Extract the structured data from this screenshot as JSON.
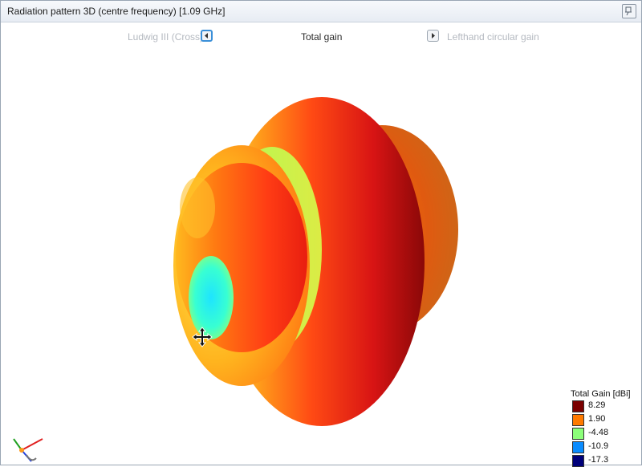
{
  "window": {
    "title": "Radiation pattern 3D (centre frequency) [1.09 GHz]"
  },
  "nav": {
    "prev_label": "Ludwig III (Cross)",
    "current_label": "Total gain",
    "next_label": "Lefthand circular gain"
  },
  "legend": {
    "title": "Total Gain [dBi]",
    "items": [
      {
        "label": "8.29",
        "color": "#7a0000"
      },
      {
        "label": "1.90",
        "color": "#ff7a00"
      },
      {
        "label": "-4.48",
        "color": "#8cff7a"
      },
      {
        "label": "-10.9",
        "color": "#0a8cff"
      },
      {
        "label": "-17.3",
        "color": "#00007a"
      }
    ]
  },
  "icons": {
    "pin": "pin-icon",
    "prev": "chevron-left-icon",
    "next": "chevron-right-icon",
    "cursor": "move-cursor-icon",
    "axes": "axis-triad-icon"
  }
}
